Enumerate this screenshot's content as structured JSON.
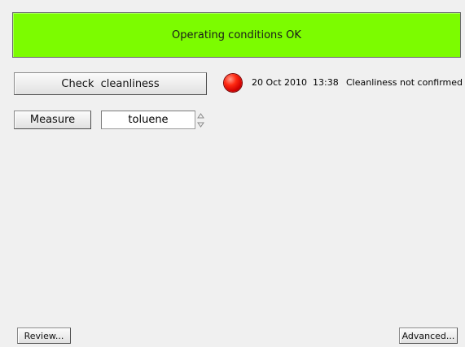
{
  "banner": {
    "text": "Operating conditions OK",
    "color": "#7cfc00"
  },
  "cleanliness": {
    "button_label": "Check  cleanliness",
    "indicator_color": "#e60000",
    "datetime": "20 Oct 2010  13:38",
    "message": "Cleanliness not confirmed"
  },
  "measure": {
    "button_label": "Measure",
    "solvent_value": "toluene"
  },
  "footer": {
    "review_label": "Review...",
    "advanced_label": "Advanced..."
  },
  "icons": {
    "status_indicator": "red-status-led",
    "stepper_up": "chevron-up-icon",
    "stepper_down": "chevron-down-icon"
  }
}
